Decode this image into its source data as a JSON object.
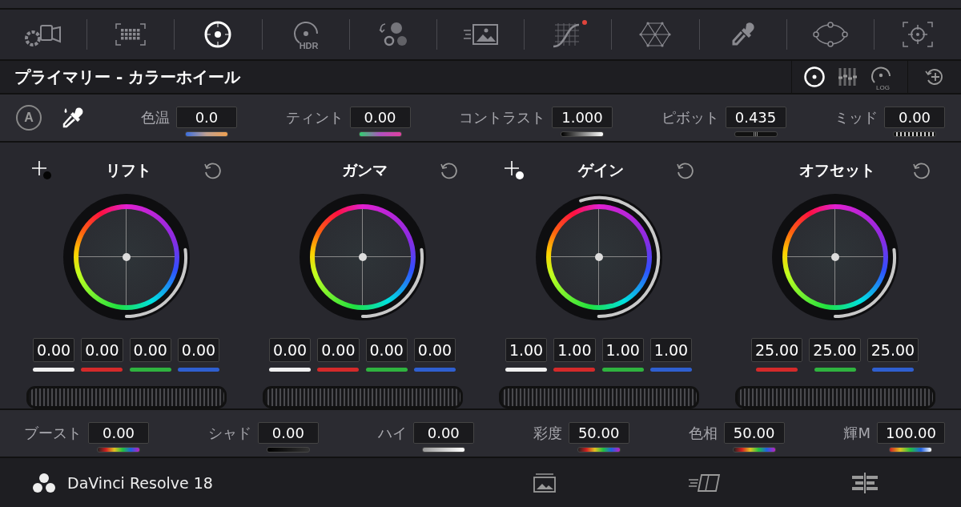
{
  "toolbar": [
    {
      "kind": "camera",
      "selected": false,
      "badge": false
    },
    {
      "kind": "chart",
      "selected": false,
      "badge": false
    },
    {
      "kind": "wheels",
      "selected": true,
      "badge": false
    },
    {
      "kind": "hdr",
      "selected": false,
      "badge": false,
      "text": "HDR"
    },
    {
      "kind": "rgbmix",
      "selected": false,
      "badge": false
    },
    {
      "kind": "motion",
      "selected": false,
      "badge": false
    },
    {
      "kind": "curves",
      "selected": false,
      "badge": true
    },
    {
      "kind": "mesh",
      "selected": false,
      "badge": false
    },
    {
      "kind": "picker",
      "selected": false,
      "badge": false
    },
    {
      "kind": "window",
      "selected": false,
      "badge": false
    },
    {
      "kind": "tracker",
      "selected": false,
      "badge": false
    }
  ],
  "panel": {
    "title": "プライマリー - カラーホイール",
    "modes": [
      {
        "kind": "wheels",
        "selected": true
      },
      {
        "kind": "bars",
        "selected": false
      },
      {
        "kind": "log",
        "selected": false,
        "text": "LOG"
      }
    ]
  },
  "top_params": [
    {
      "label": "色温",
      "value": "0.0",
      "kind": "temp"
    },
    {
      "label": "ティント",
      "value": "0.00",
      "kind": "tint"
    },
    {
      "label": "コントラスト",
      "value": "1.000",
      "kind": "contrast"
    },
    {
      "label": "ピボット",
      "value": "0.435",
      "kind": "pivot"
    },
    {
      "label": "ミッド",
      "value": "0.00",
      "kind": "mid"
    }
  ],
  "auto_button": {
    "text": "A"
  },
  "wheels": [
    {
      "title": "リフト",
      "kind": "dark_picker",
      "level": 0.27,
      "values": [
        {
          "value": "0.00",
          "color": "#f0f0f0"
        },
        {
          "value": "0.00",
          "color": "#d42a2a"
        },
        {
          "value": "0.00",
          "color": "#2fb33f"
        },
        {
          "value": "0.00",
          "color": "#2f5fd0"
        }
      ]
    },
    {
      "title": "ガンマ",
      "kind": "plain",
      "level": 0.27,
      "values": [
        {
          "value": "0.00",
          "color": "#f0f0f0"
        },
        {
          "value": "0.00",
          "color": "#d42a2a"
        },
        {
          "value": "0.00",
          "color": "#2fb33f"
        },
        {
          "value": "0.00",
          "color": "#2f5fd0"
        }
      ]
    },
    {
      "title": "ゲイン",
      "kind": "light_picker",
      "level": 0.55,
      "values": [
        {
          "value": "1.00",
          "color": "#f0f0f0"
        },
        {
          "value": "1.00",
          "color": "#d42a2a"
        },
        {
          "value": "1.00",
          "color": "#2fb33f"
        },
        {
          "value": "1.00",
          "color": "#2f5fd0"
        }
      ]
    },
    {
      "title": "オフセット",
      "kind": "plain",
      "level": 0.27,
      "values": [
        {
          "value": "25.00",
          "color": "#d42a2a"
        },
        {
          "value": "25.00",
          "color": "#2fb33f"
        },
        {
          "value": "25.00",
          "color": "#2f5fd0"
        }
      ]
    }
  ],
  "bottom_params": [
    {
      "label": "ブースト",
      "value": "0.00",
      "kind": "rainbow"
    },
    {
      "label": "シャド",
      "value": "0.00",
      "kind": "dark"
    },
    {
      "label": "ハイ",
      "value": "0.00",
      "kind": "light"
    },
    {
      "label": "彩度",
      "value": "50.00",
      "kind": "rainbow"
    },
    {
      "label": "色相",
      "value": "50.00",
      "kind": "rainbow"
    },
    {
      "label": "輝M",
      "value": "100.00",
      "kind": "luma"
    }
  ],
  "footer": {
    "app_name": "DaVinci Resolve 18",
    "pages": [
      {
        "kind": "media"
      },
      {
        "kind": "cut"
      },
      {
        "kind": "edit"
      }
    ]
  }
}
